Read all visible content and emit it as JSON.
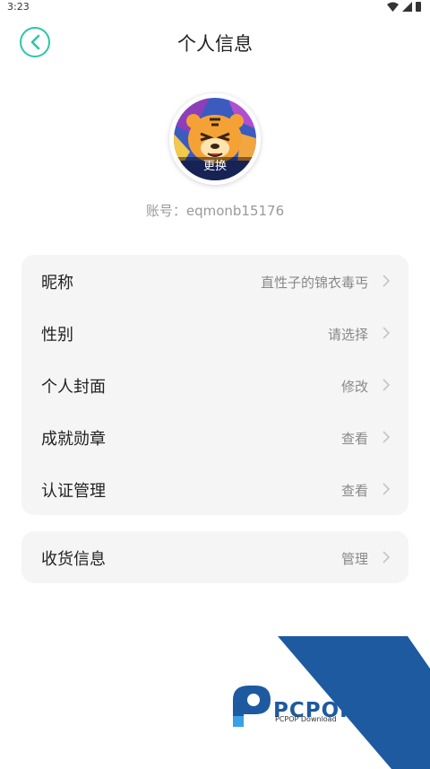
{
  "status_bar": {
    "time": "3:23"
  },
  "header": {
    "title": "个人信息"
  },
  "avatar": {
    "change_label": "更换"
  },
  "account": {
    "label": "账号：",
    "value": "eqmonb15176"
  },
  "profile_rows": [
    {
      "label": "昵称",
      "value": "直性子的锦衣毒丐"
    },
    {
      "label": "性别",
      "value": "请选择"
    },
    {
      "label": "个人封面",
      "value": "修改"
    },
    {
      "label": "成就勋章",
      "value": "查看"
    },
    {
      "label": "认证管理",
      "value": "查看"
    }
  ],
  "shipping_row": {
    "label": "收货信息",
    "value": "管理"
  },
  "watermark": {
    "brand": "PCPOP下载",
    "sub": "PCPOP Download"
  },
  "colors": {
    "accent": "#2cc6a8",
    "card_bg": "#f5f5f5",
    "watermark_blue": "#1e5aa0"
  }
}
